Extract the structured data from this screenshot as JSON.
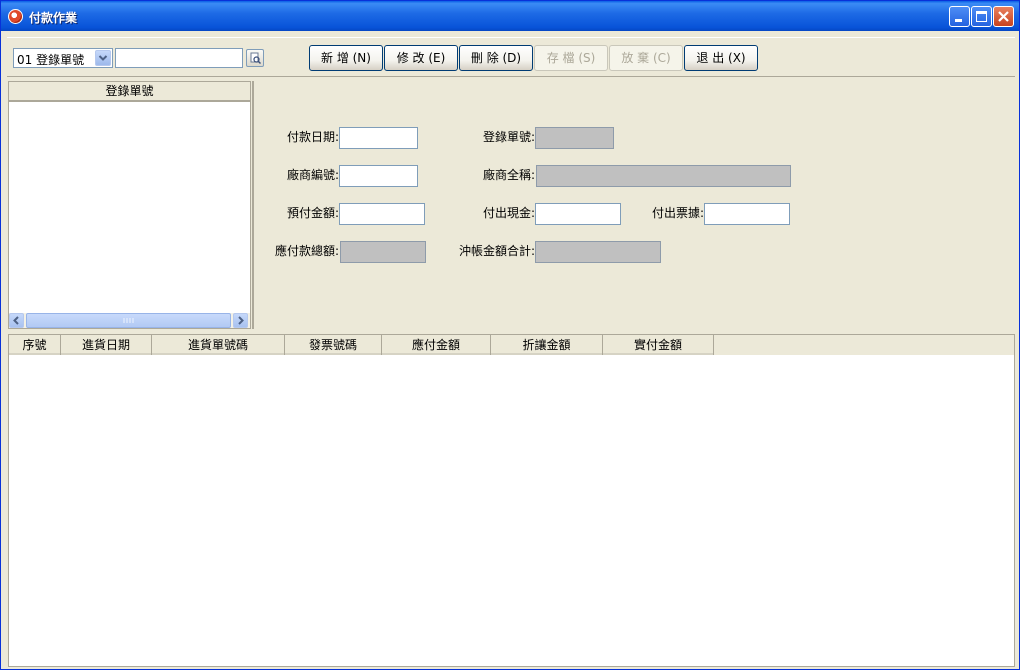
{
  "window": {
    "title": "付款作業",
    "icon": "app-icon",
    "controls": [
      "minimize-icon",
      "maximize-icon",
      "close-icon"
    ]
  },
  "toolbar": {
    "search_field": {
      "selected": "01 登錄單號",
      "value": ""
    },
    "buttons": {
      "add": "新 增 (N)",
      "edit": "修 改 (E)",
      "delete": "刪 除 (D)",
      "save": "存 檔 (S)",
      "cancel": "放 棄 (C)",
      "exit": "退 出 (X)"
    }
  },
  "list": {
    "header": "登錄單號"
  },
  "form": {
    "pay_date": "付款日期:",
    "reg_no": "登錄單號:",
    "vendor_no": "廠商編號:",
    "vendor_name": "廠商全稱:",
    "prepaid": "預付金額:",
    "cash_out": "付出現金:",
    "bill_out": "付出票據:",
    "total_payable": "應付款總額:",
    "offset_total": "沖帳金額合計:"
  },
  "grid": {
    "columns": [
      "序號",
      "進貨日期",
      "進貨單號碼",
      "發票號碼",
      "應付金額",
      "折讓金額",
      "實付金額"
    ]
  },
  "colors": {
    "titlebar": "#0A5FE6",
    "face": "#ECE9D8",
    "readonly": "#C0C0C0"
  }
}
